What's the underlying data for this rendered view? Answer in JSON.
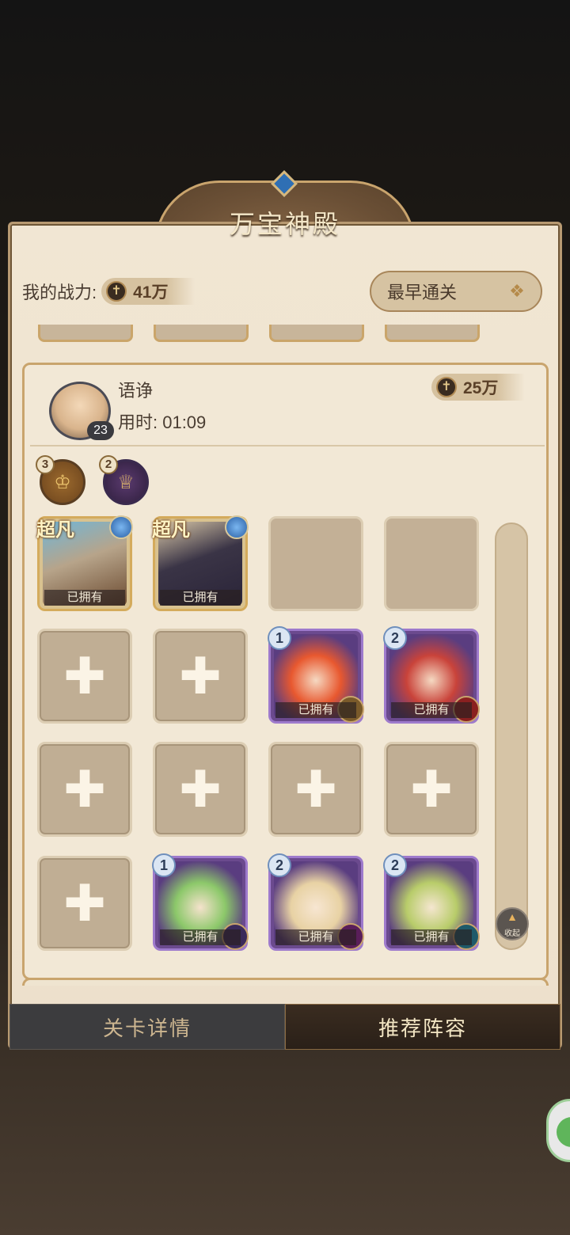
{
  "header": {
    "title": "万宝神殿"
  },
  "my_power": {
    "label": "我的战力:",
    "value": "41万"
  },
  "sort": {
    "label": "最早通关"
  },
  "record": {
    "player_name": "语诤",
    "time_label": "用时: 01:09",
    "level": "23",
    "power": "25万",
    "factions": [
      {
        "count": "3",
        "icon": "lion-crest-icon"
      },
      {
        "count": "2",
        "icon": "crown-crest-icon"
      }
    ],
    "heroes": [
      {
        "tier": "超凡",
        "status": "已拥有"
      },
      {
        "tier": "超凡",
        "status": "已拥有"
      },
      {
        "stars": "1",
        "status": "已拥有"
      },
      {
        "stars": "2",
        "status": "已拥有"
      },
      {
        "stars": "1",
        "status": "已拥有"
      },
      {
        "stars": "2",
        "status": "已拥有"
      },
      {
        "stars": "2",
        "status": "已拥有"
      }
    ]
  },
  "collapse": {
    "label": "收起"
  },
  "tabs": [
    {
      "label": "关卡详情"
    },
    {
      "label": "推荐阵容"
    }
  ],
  "colors": {
    "panel_bg": "#f1e6d3",
    "gold_border": "#c9a46d",
    "purple_border": "#9e7acc",
    "dark_tab": "#3c3c3e"
  }
}
